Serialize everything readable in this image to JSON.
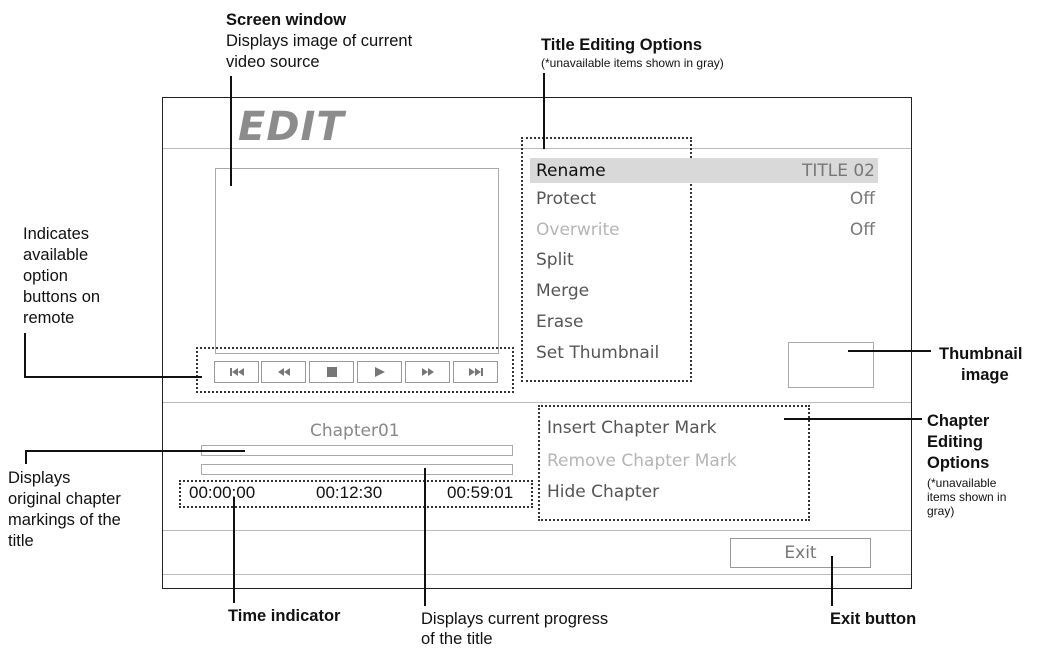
{
  "screen": {
    "title": "EDIT",
    "menu": [
      {
        "label": "Rename",
        "value": "TITLE 02",
        "state": "selected"
      },
      {
        "label": "Protect",
        "value": "Off",
        "state": "normal"
      },
      {
        "label": "Overwrite",
        "value": "Off",
        "state": "unavailable"
      },
      {
        "label": "Split",
        "value": "",
        "state": "normal"
      },
      {
        "label": "Merge",
        "value": "",
        "state": "normal"
      },
      {
        "label": "Erase",
        "value": "",
        "state": "normal"
      },
      {
        "label": "Set Thumbnail",
        "value": "",
        "state": "normal"
      }
    ],
    "controls": [
      "skip-back-icon",
      "rewind-icon",
      "stop-icon",
      "play-icon",
      "fast-forward-icon",
      "skip-forward-icon"
    ],
    "chapter_label": "Chapter01",
    "times": {
      "start": "00:00:00",
      "current": "00:12:30",
      "end": "00:59:01"
    },
    "chapter_options": [
      {
        "label": "Insert Chapter Mark",
        "state": "normal"
      },
      {
        "label": "Remove Chapter Mark",
        "state": "unavailable"
      },
      {
        "label": "Hide Chapter",
        "state": "normal"
      }
    ],
    "exit_label": "Exit"
  },
  "callouts": {
    "screen_window": {
      "title": "Screen window",
      "text": [
        "Displays image of current",
        "video source"
      ]
    },
    "title_editing": {
      "title": "Title Editing Options",
      "note": "(*unavailable items shown in gray)"
    },
    "option_buttons": {
      "text": [
        "Indicates",
        "available",
        "option",
        "buttons on",
        "remote"
      ]
    },
    "thumbnail": {
      "title": [
        "Thumbnail",
        "image"
      ]
    },
    "chapter_editing": {
      "title": [
        "Chapter",
        "Editing",
        "Options"
      ],
      "note": [
        "(*unavailable",
        "items shown in",
        "gray)"
      ]
    },
    "chapter_markings": {
      "text": [
        "Displays",
        "original chapter",
        "markings of the",
        "title"
      ]
    },
    "time_indicator": {
      "title": "Time indicator"
    },
    "progress": {
      "text": [
        "Displays current progress",
        "of the title"
      ]
    },
    "exit_button": {
      "title": "Exit button"
    }
  },
  "colors": {
    "selected_bg": "#d9d9d9",
    "unavailable_text": "#b5b5b5",
    "normal_text": "#555555",
    "title_text": "#8c8c8c"
  }
}
